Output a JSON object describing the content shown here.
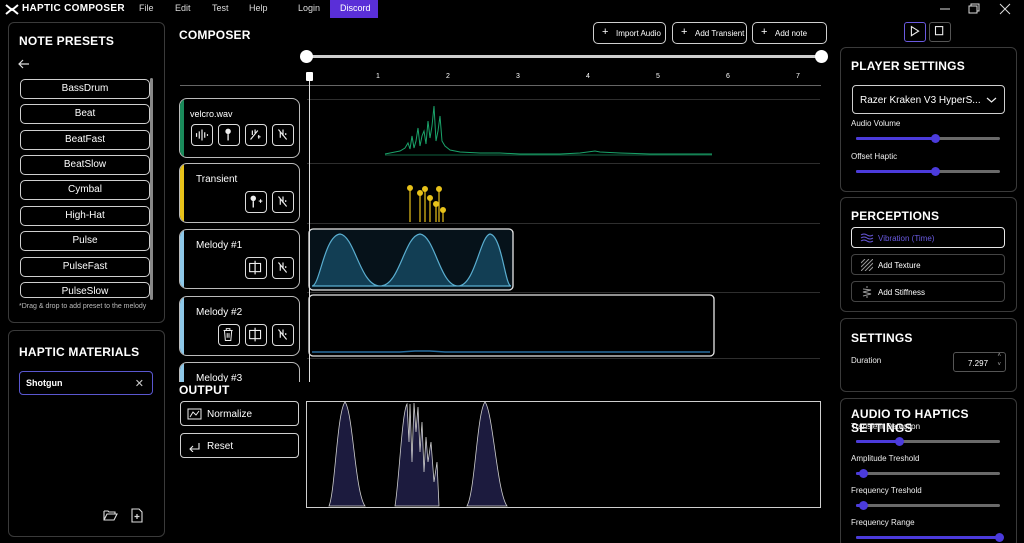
{
  "app": {
    "title": "HAPTIC COMPOSER"
  },
  "menu": [
    "File",
    "Edit",
    "Test",
    "Help",
    "Login",
    "Discord"
  ],
  "note_presets": {
    "title": "NOTE PRESETS",
    "items": [
      "BassDrum",
      "Beat",
      "BeatFast",
      "BeatSlow",
      "Cymbal",
      "High-Hat",
      "Pulse",
      "PulseFast",
      "PulseSlow"
    ],
    "hint": "*Drag & drop to add preset to the melody"
  },
  "haptic_materials": {
    "title": "HAPTIC MATERIALS",
    "selected": "Shotgun"
  },
  "composer": {
    "title": "COMPOSER",
    "buttons": {
      "import_audio": "Import Audio",
      "add_transient": "Add Transient",
      "add_note": "Add note"
    },
    "ruler": [
      "1",
      "2",
      "3",
      "4",
      "5",
      "6",
      "7"
    ],
    "tracks": {
      "velcro": "velcro.wav",
      "transient": "Transient",
      "melody1": "Melody #1",
      "melody2": "Melody #2",
      "melody3": "Melody #3"
    },
    "colors": {
      "audio": "#1a8a5a",
      "transient": "#e8c21a",
      "melody": "#8ec8e8",
      "accent": "#4b3bdc"
    }
  },
  "output": {
    "title": "OUTPUT",
    "normalize": "Normalize",
    "reset": "Reset"
  },
  "player_settings": {
    "title": "PLAYER SETTINGS",
    "device": "Razer Kraken V3 HyperS...",
    "audio_volume_label": "Audio Volume",
    "audio_volume": 0.55,
    "offset_haptic_label": "Offset Haptic",
    "offset_haptic": 0.55
  },
  "perceptions": {
    "title": "PERCEPTIONS",
    "vibration": "Vibration (Time)",
    "add_texture": "Add Texture",
    "add_stiffness": "Add Stiffness"
  },
  "settings": {
    "title": "SETTINGS",
    "duration_label": "Duration",
    "duration_value": "7.297"
  },
  "audio_to_haptics": {
    "title": "AUDIO TO HAPTICS SETTINGS",
    "transient_detection_label": "Transient Detection",
    "transient_detection": 0.3,
    "amplitude_threshold_label": "Amplitude Treshold",
    "amplitude_threshold": 0.05,
    "frequency_threshold_label": "Frequency Treshold",
    "frequency_threshold": 0.05,
    "frequency_range_label": "Frequency Range",
    "frequency_range": 1.0
  }
}
